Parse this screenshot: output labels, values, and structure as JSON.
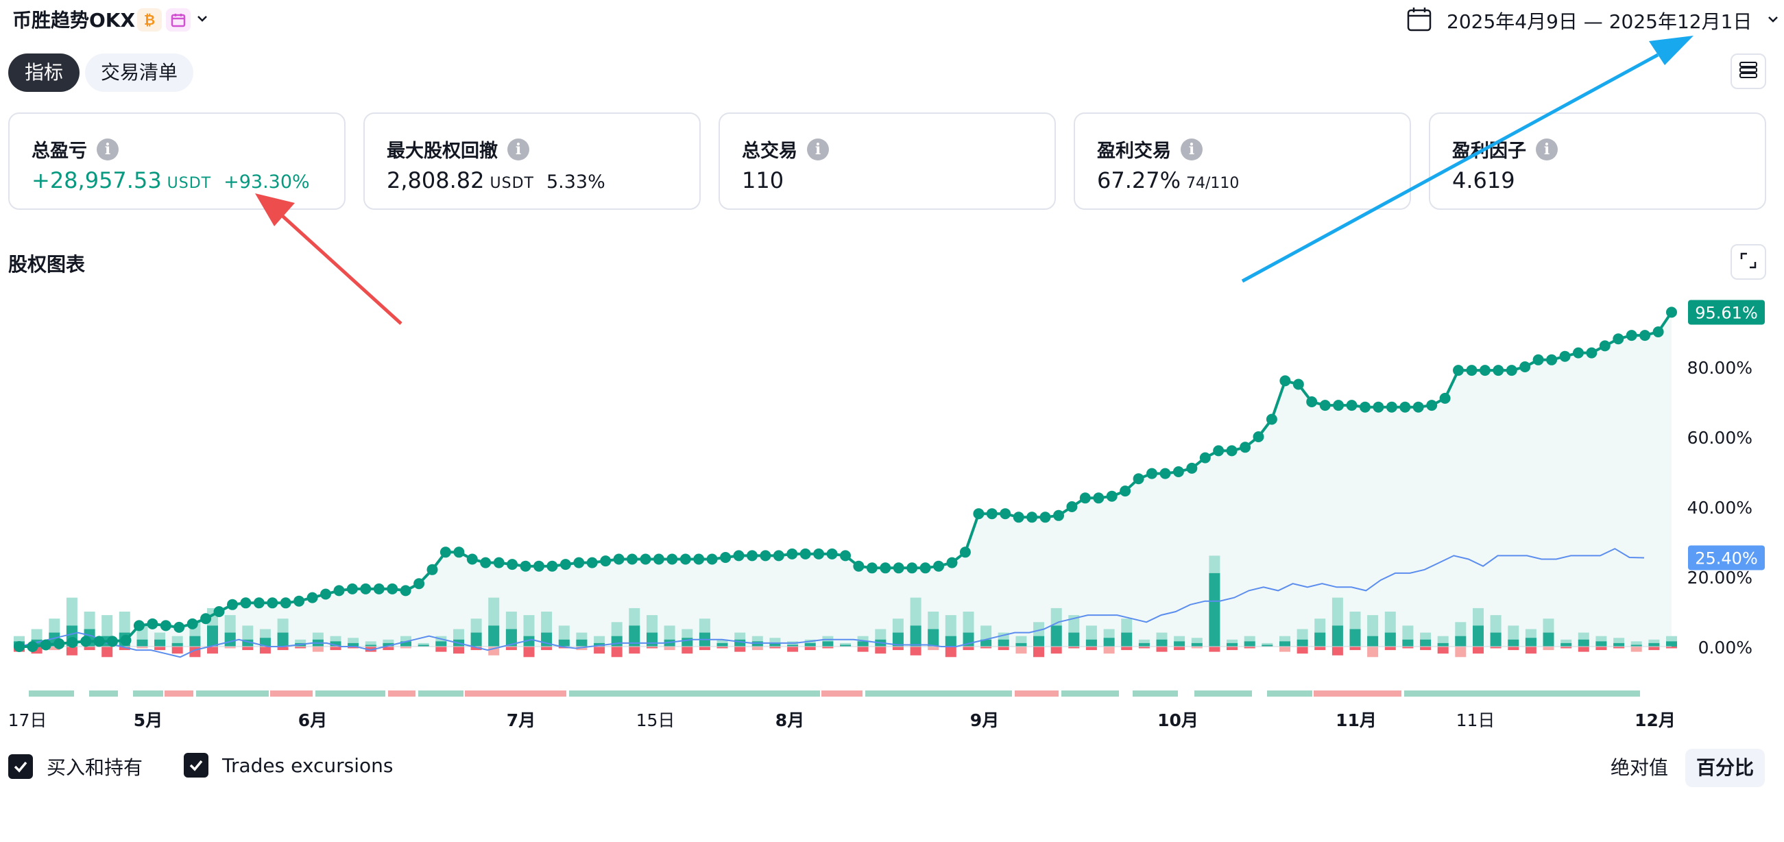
{
  "header": {
    "strategy_name": "币胜趋势OKX",
    "date_range": "2025年4月9日 — 2025年12月1日"
  },
  "tabs": [
    {
      "label": "指标",
      "active": true
    },
    {
      "label": "交易清单",
      "active": false
    }
  ],
  "metrics": [
    {
      "label": "总盈亏",
      "value": "+28,957.53",
      "unit": "USDT",
      "extra": "+93.30%",
      "color": "#089981"
    },
    {
      "label": "最大股权回撤",
      "value": "2,808.82",
      "unit": "USDT",
      "extra": "5.33%"
    },
    {
      "label": "总交易",
      "value": "110"
    },
    {
      "label": "盈利交易",
      "value": "67.27%",
      "sub": "74/110"
    },
    {
      "label": "盈利因子",
      "value": "4.619"
    }
  ],
  "chart_section": {
    "title": "股权图表"
  },
  "chart_data": {
    "type": "line",
    "x_tick_labels": [
      "17日",
      "5月",
      "6月",
      "7月",
      "15日",
      "8月",
      "9月",
      "10月",
      "11月",
      "11日",
      "12月"
    ],
    "y_tick_labels": [
      "0.00%",
      "20.00%",
      "40.00%",
      "60.00%",
      "80.00%"
    ],
    "ylim": [
      -7,
      100
    ],
    "series": [
      {
        "color": "#089981",
        "last_label": "95.61%",
        "values": [
          0,
          0,
          0.5,
          0.8,
          1.2,
          1.5,
          1.5,
          1.5,
          1.8,
          6,
          6.5,
          6,
          5.5,
          6.5,
          8,
          10,
          12,
          12.5,
          12.5,
          12.5,
          12.5,
          13,
          14,
          15,
          16,
          16.5,
          16.5,
          16.5,
          16.5,
          16,
          18,
          22,
          27,
          27,
          25,
          24,
          24,
          23.5,
          23,
          23,
          23,
          23.5,
          24,
          24,
          24.5,
          25,
          25,
          25,
          25,
          25,
          25,
          25,
          25,
          25.5,
          26,
          26,
          26,
          26,
          26.5,
          26.5,
          26.5,
          26.5,
          26,
          23,
          22.5,
          22.5,
          22.5,
          22.5,
          22.5,
          23,
          24,
          27,
          38,
          38,
          38,
          37,
          37,
          37,
          37.5,
          40,
          42.5,
          42.5,
          43,
          44.5,
          48,
          49.5,
          49.5,
          50,
          51,
          54,
          56,
          56,
          57,
          60,
          65,
          76,
          75,
          70,
          69,
          69,
          69,
          68.5,
          68.5,
          68.5,
          68.5,
          68.5,
          69,
          71,
          79,
          79,
          79,
          79,
          79,
          80,
          82,
          82,
          83,
          84,
          84,
          86,
          88,
          89,
          89,
          90,
          95.6
        ]
      },
      {
        "color": "#5b8def",
        "last_label": "25.40%",
        "values": [
          0,
          1,
          2,
          3,
          4,
          3,
          1,
          0,
          -1,
          -1,
          -2,
          -3,
          -1,
          0,
          1,
          2,
          1,
          0,
          0,
          0.5,
          1,
          1,
          0,
          0,
          -1,
          0,
          1,
          2,
          3,
          2,
          1,
          0,
          -1,
          0,
          1,
          2,
          1,
          0,
          -0.5,
          0,
          0.5,
          1,
          1,
          1,
          1,
          1.5,
          2,
          2,
          2,
          1.5,
          1,
          1,
          1,
          1,
          1.5,
          2,
          2,
          2,
          1.5,
          1,
          0.5,
          0.5,
          0.5,
          0,
          0,
          1,
          2,
          3,
          4,
          4,
          5,
          7,
          8,
          9,
          9,
          9,
          8,
          7,
          9,
          10,
          12,
          13,
          13,
          14,
          16,
          17,
          16,
          18,
          17,
          18,
          17,
          17,
          16,
          19,
          21,
          21,
          22,
          24,
          26,
          25,
          23,
          26,
          26,
          26,
          25,
          25,
          26,
          26,
          26,
          28,
          25.5,
          25.4
        ]
      }
    ],
    "trade_bars": [
      {
        "v": 3,
        "dark": 1.5,
        "neg": -1.5
      },
      {
        "v": 5,
        "dark": 2,
        "neg": -2
      },
      {
        "v": 8,
        "dark": 4,
        "neg": -1
      },
      {
        "v": 14,
        "dark": 6,
        "neg": -2.5
      },
      {
        "v": 10,
        "dark": 5,
        "neg": -1
      },
      {
        "v": 9,
        "dark": 3,
        "neg": -3
      },
      {
        "v": 10,
        "dark": 4,
        "neg": -1
      },
      {
        "v": 6,
        "dark": 2,
        "neg": -0.5
      },
      {
        "v": 4,
        "dark": 2,
        "neg": -1
      },
      {
        "v": 3,
        "dark": 1,
        "neg": -2
      },
      {
        "v": 7,
        "dark": 3,
        "neg": -3
      },
      {
        "v": 11,
        "dark": 6,
        "neg": -2
      },
      {
        "v": 9,
        "dark": 4,
        "neg": -0.5
      },
      {
        "v": 6,
        "dark": 2,
        "neg": -1
      },
      {
        "v": 5,
        "dark": 2.5,
        "neg": -2
      },
      {
        "v": 8,
        "dark": 4,
        "neg": -1
      },
      {
        "v": 2,
        "dark": 1,
        "neg": -0.5
      },
      {
        "v": 4,
        "dark": 2,
        "neg": -1.5
      },
      {
        "v": 3,
        "dark": 1.5,
        "neg": -1
      },
      {
        "v": 2.5,
        "dark": 1,
        "neg": -0.5
      },
      {
        "v": 1.5,
        "dark": 0.5,
        "neg": -1.5
      },
      {
        "v": 2,
        "dark": 1,
        "neg": -1
      },
      {
        "v": 3,
        "dark": 1.5,
        "neg": -0.5
      },
      {
        "v": 1,
        "dark": 0.5,
        "neg": -0.3
      }
    ]
  },
  "legend": {
    "buy_hold_label": "买入和持有",
    "trades_label": "Trades excursions"
  },
  "view_toggle": {
    "absolute": "绝对值",
    "percent": "百分比"
  },
  "colors": {
    "accent": "#089981",
    "negative": "#f23645",
    "benchmark": "#5b8def",
    "arrow_red": "#ee4d4d",
    "arrow_blue": "#18a8ee"
  }
}
